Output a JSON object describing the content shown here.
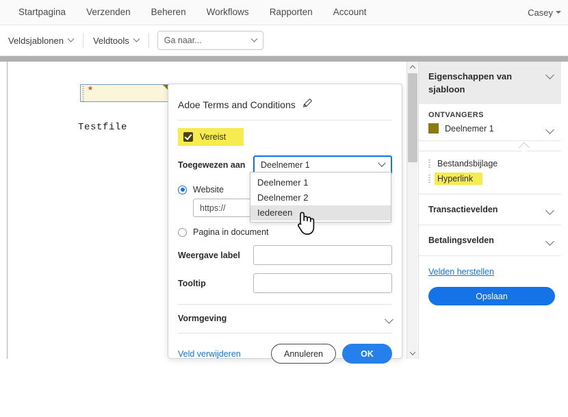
{
  "topnav": {
    "items": [
      {
        "label": "Startpagina"
      },
      {
        "label": "Verzenden"
      },
      {
        "label": "Beheren"
      },
      {
        "label": "Workflows"
      },
      {
        "label": "Rapporten"
      },
      {
        "label": "Account"
      }
    ],
    "user": "Casey"
  },
  "toolbar": {
    "fieldtemplates": "Veldsjablonen",
    "fieldtools": "Veldtools",
    "goto_value": "Ga naar..."
  },
  "document": {
    "field_marker": "*",
    "body_text": "Testfile"
  },
  "dialog": {
    "title": "Adoe Terms and Conditions",
    "required_label": "Vereist",
    "assigned_label": "Toegewezen aan",
    "assigned_value": "Deelnemer 1",
    "dropdown_options": [
      {
        "label": "Deelnemer 1",
        "selected": false
      },
      {
        "label": "Deelnemer 2",
        "selected": false
      },
      {
        "label": "Iedereen",
        "selected": true
      }
    ],
    "radio_website": "Website",
    "url_value": "https://",
    "radio_page": "Pagina in document",
    "display_label": "Weergave label",
    "display_value": "",
    "tooltip_label": "Tooltip",
    "tooltip_value": "",
    "appearance_label": "Vormgeving",
    "delete_link": "Veld verwijderen",
    "cancel_button": "Annuleren",
    "ok_button": "OK"
  },
  "rightpanel": {
    "header_title": "Eigenschappen van sjabloon",
    "recipients_title": "ONTVANGERS",
    "recipient_name": "Deelnemer 1",
    "recipient_color": "#8a7a0f",
    "fields": [
      {
        "label": "Bestandsbijlage",
        "highlighted": false
      },
      {
        "label": "Hyperlink",
        "highlighted": true
      }
    ],
    "sections": [
      {
        "label": "Transactievelden"
      },
      {
        "label": "Betalingsvelden"
      }
    ],
    "reset_link": "Velden herstellen",
    "save_button": "Opslaan"
  }
}
